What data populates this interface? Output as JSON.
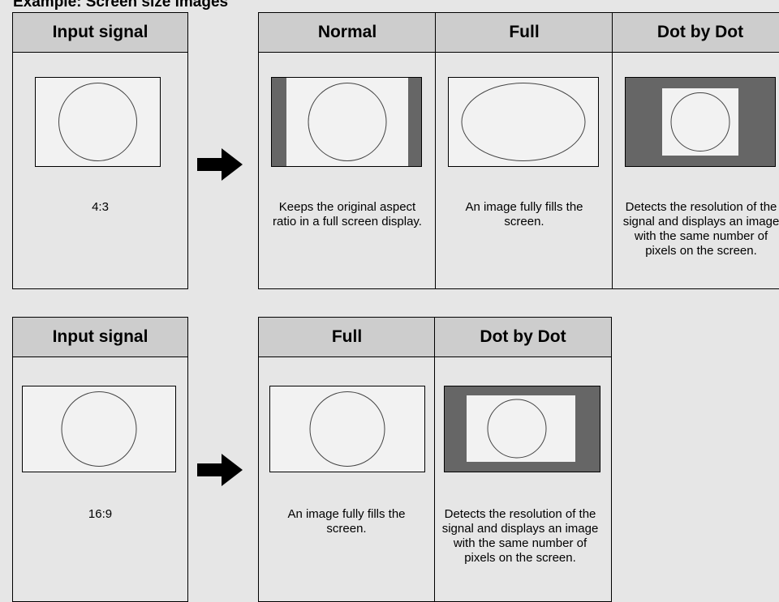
{
  "heading": "Example: Screen size images",
  "block1": {
    "input_header": "Input signal",
    "input_label": "4:3",
    "modes": [
      {
        "title": "Normal",
        "desc": "Keeps the original aspect ratio in a full screen display."
      },
      {
        "title": "Full",
        "desc": "An image fully fills the screen."
      },
      {
        "title": "Dot by Dot",
        "desc": "Detects the resolution of the signal and displays an image with the same number of pixels on the screen."
      }
    ]
  },
  "block2": {
    "input_header": "Input signal",
    "input_label": "16:9",
    "modes": [
      {
        "title": "Full",
        "desc": "An image fully fills the screen."
      },
      {
        "title": "Dot by Dot",
        "desc": "Detects the resolution of the signal and displays an image with the same number of pixels on the screen."
      }
    ]
  },
  "colors": {
    "background": "#e6e6e6",
    "header": "#cdcdcd",
    "screen_dark": "#666666",
    "screen_light": "#f2f2f2"
  }
}
